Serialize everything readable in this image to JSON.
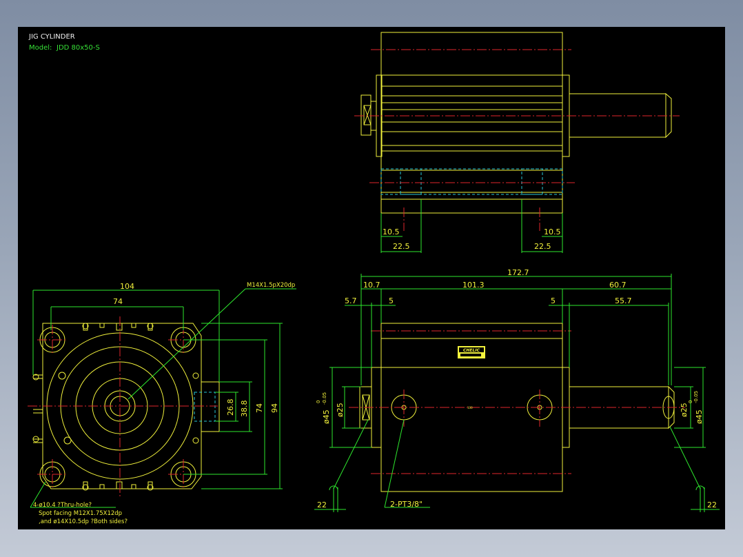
{
  "drawing": {
    "title": "JIG CYLINDER",
    "model_label": "Model:",
    "model_value": "JDD 80x50-S",
    "colors": {
      "background": "#000000",
      "outline": "#f2f23c",
      "dimension": "#2ee82e",
      "centerline": "#e0262c",
      "hidden": "#28c8d8"
    }
  },
  "top_view": {
    "dims": {
      "left_small": "10.5",
      "right_small": "10.5",
      "left_large": "22.5",
      "right_large": "22.5"
    }
  },
  "end_view": {
    "dims": {
      "width_outer": "104",
      "width_inner": "74",
      "height_outer": "94",
      "height_inner": "74",
      "port_a": "26.8",
      "port_b": "38.8"
    },
    "thread_note": "M14X1.5pX20dp",
    "mount_note_1": "4-ø10.4 ?Thru-hole?",
    "mount_note_2": "Spot facing  M12X1.75X12dp",
    "mount_note_3": ",and ø14X10.5dp ?Both sides?"
  },
  "side_view": {
    "dims": {
      "overall": "172.7",
      "seg_a": "10.7",
      "seg_b": "101.3",
      "seg_c": "60.7",
      "small_a": "5.7",
      "small_b": "5",
      "small_c": "5",
      "seg_d": "55.7",
      "bore_left": "ø25",
      "bore_right": "ø25",
      "left_tol": "ø45",
      "right_tol": "ø45",
      "tol": "-0.05",
      "tol_zero": "0",
      "left_bottom": "22",
      "right_bottom": "22"
    },
    "port_note": "2-PT3/8\"",
    "brand_label": "CHELIC",
    "center_mark": "100"
  }
}
